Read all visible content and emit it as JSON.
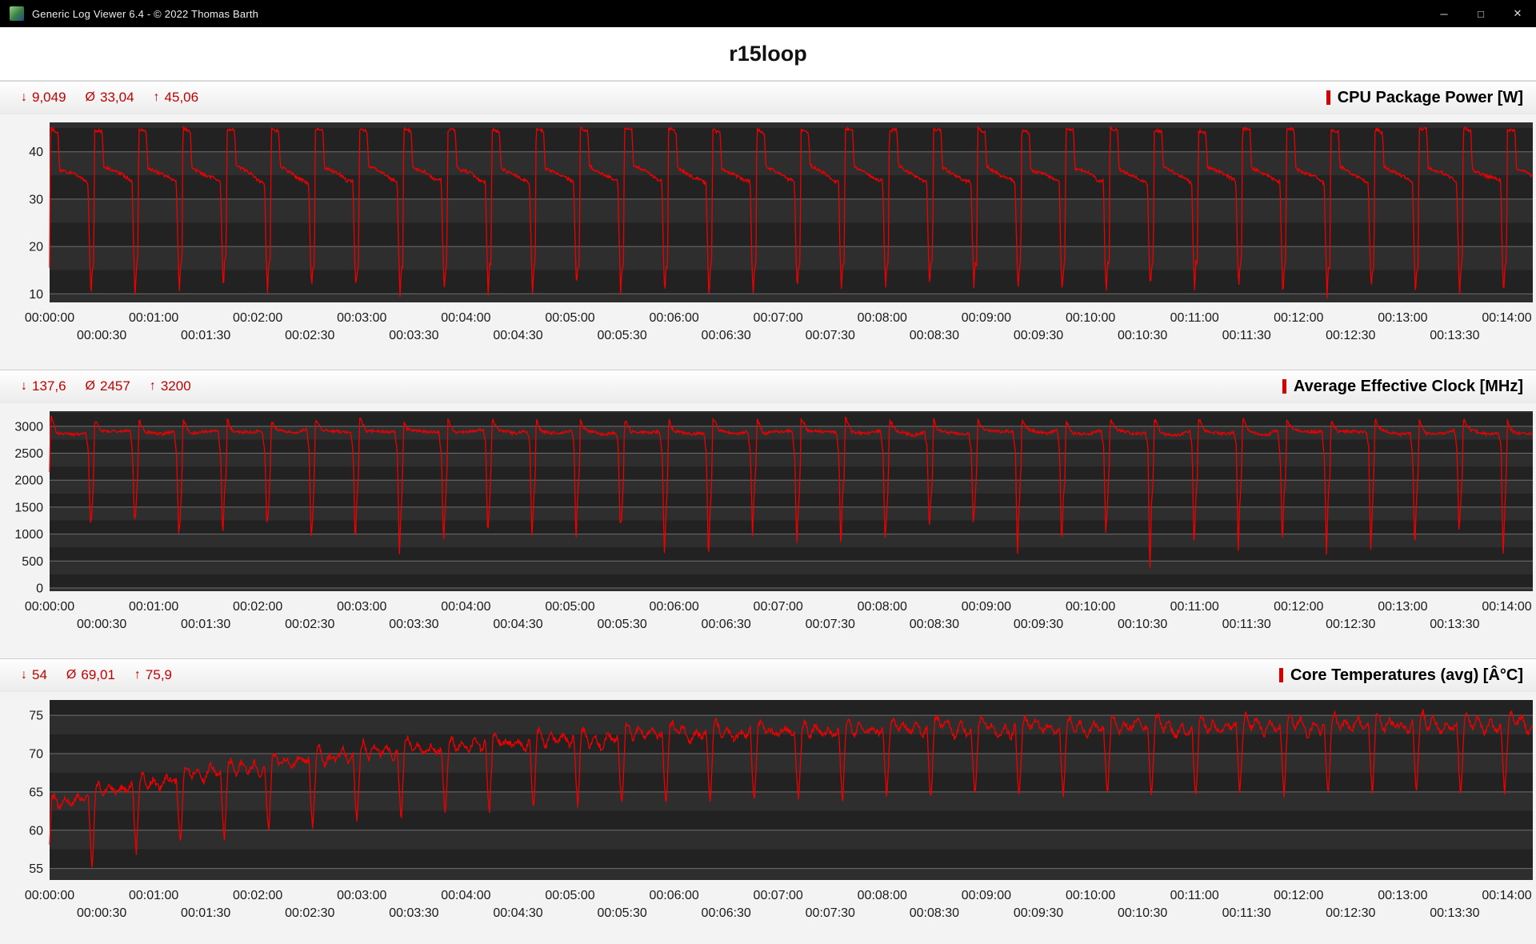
{
  "window": {
    "title": "Generic Log Viewer 6.4 - © 2022 Thomas Barth",
    "controls": {
      "minimize": "─",
      "maximize": "□",
      "close": "✕"
    }
  },
  "header": {
    "title": "r15loop"
  },
  "stats_glyphs": {
    "min": "↓",
    "avg": "Ø",
    "max": "↑"
  },
  "plot_colors": {
    "bg": "#1c1c1c",
    "stripe_light": "#2e2e2e",
    "stripe_dark": "#222222",
    "grid": "#6e6e6e",
    "tick_text": "#1a1a1a"
  },
  "axis": {
    "x_range": [
      0,
      855
    ],
    "row1_labels": [
      "00:00:00",
      "00:01:00",
      "00:02:00",
      "00:03:00",
      "00:04:00",
      "00:05:00",
      "00:06:00",
      "00:07:00",
      "00:08:00",
      "00:09:00",
      "00:10:00",
      "00:11:00",
      "00:12:00",
      "00:13:00",
      "00:14:00"
    ],
    "row1_seconds": [
      0,
      60,
      120,
      180,
      240,
      300,
      360,
      420,
      480,
      540,
      600,
      660,
      720,
      780,
      840
    ],
    "row2_labels": [
      "00:00:30",
      "00:01:30",
      "00:02:30",
      "00:03:30",
      "00:04:30",
      "00:05:30",
      "00:06:30",
      "00:07:30",
      "00:08:30",
      "00:09:30",
      "00:10:30",
      "00:11:30",
      "00:12:30",
      "00:13:30"
    ],
    "row2_seconds": [
      30,
      90,
      150,
      210,
      270,
      330,
      390,
      450,
      510,
      570,
      630,
      690,
      750,
      810
    ]
  },
  "chart_data": [
    {
      "type": "line",
      "name": "cpu-package-power",
      "title": "CPU Package Power [W]",
      "stats_display": {
        "min": "9,049",
        "avg": "33,04",
        "max": "45,06"
      },
      "legend_color": "#d40000",
      "line_color": "#ee0000",
      "y_ticks": [
        40,
        30,
        20,
        10
      ],
      "y_range": [
        8.2,
        46.2
      ],
      "stripe_step": 5,
      "series": {
        "mode": "absolute",
        "period": 25.45,
        "noise": 0.35,
        "seed": 3,
        "keypoints": [
          [
            0.0,
            17,
            1.5
          ],
          [
            0.02,
            44.8,
            0.4
          ],
          [
            0.19,
            44.3,
            0.5
          ],
          [
            0.225,
            36.6,
            0.6
          ],
          [
            0.56,
            35.2,
            0.5
          ],
          [
            0.74,
            34.2,
            0.4
          ],
          [
            0.87,
            33.6,
            0.4
          ],
          [
            0.905,
            19,
            2
          ],
          [
            0.935,
            10.3,
            1.4
          ],
          [
            0.962,
            15.5,
            1.5
          ],
          [
            1.0,
            17,
            1.5
          ]
        ],
        "overrides": [
          {
            "cycle": 0,
            "kp": 1,
            "value": 45.0
          }
        ]
      }
    },
    {
      "type": "line",
      "name": "average-effective-clock",
      "title": "Average Effective Clock [MHz]",
      "stats_display": {
        "min": "137,6",
        "avg": "2457",
        "max": "3200"
      },
      "legend_color": "#d40000",
      "line_color": "#ee0000",
      "y_ticks": [
        3000,
        2500,
        2000,
        1500,
        1000,
        500,
        0
      ],
      "y_range": [
        -60,
        3280
      ],
      "stripe_step": 250,
      "series": {
        "mode": "absolute",
        "period": 25.45,
        "noise": 28,
        "seed": 11,
        "keypoints": [
          [
            0.0,
            2150,
            150
          ],
          [
            0.022,
            3130,
            50
          ],
          [
            0.09,
            3010,
            60
          ],
          [
            0.17,
            2900,
            40
          ],
          [
            0.56,
            2870,
            40
          ],
          [
            0.82,
            2905,
            40
          ],
          [
            0.878,
            2550,
            180
          ],
          [
            0.922,
            780,
            420
          ],
          [
            0.957,
            1500,
            260
          ],
          [
            1.0,
            2150,
            150
          ]
        ],
        "overrides": [
          {
            "cycle": 0,
            "kp": 1,
            "value": 3200
          },
          {
            "cycle": 24,
            "kp": 7,
            "value": 145
          }
        ]
      }
    },
    {
      "type": "line",
      "name": "core-temperatures-avg",
      "title": "Core Temperatures (avg) [Â°C]",
      "stats_display": {
        "min": "54",
        "avg": "69,01",
        "max": "75,9"
      },
      "legend_color": "#d40000",
      "line_color": "#ee0000",
      "y_ticks": [
        75,
        70,
        65,
        60,
        55
      ],
      "y_range": [
        53.5,
        77.0
      ],
      "stripe_step": 2.5,
      "series": {
        "mode": "envelope",
        "period": 25.45,
        "noise": 0.4,
        "seed": 21,
        "peak_start": 64.6,
        "peak_end": 75.4,
        "tau": 175,
        "span": 11,
        "keypoints": [
          [
            0.0,
            0.42,
            0.05
          ],
          [
            0.045,
            0.93,
            0.05
          ],
          [
            0.105,
            1.0,
            0.03
          ],
          [
            0.22,
            0.8,
            0.06
          ],
          [
            0.34,
            0.93,
            0.05
          ],
          [
            0.5,
            0.77,
            0.06
          ],
          [
            0.64,
            0.92,
            0.05
          ],
          [
            0.78,
            0.78,
            0.06
          ],
          [
            0.875,
            0.88,
            0.05
          ],
          [
            0.925,
            0.3,
            0.07
          ],
          [
            0.962,
            0.02,
            0.03
          ],
          [
            1.0,
            0.42,
            0.05
          ]
        ],
        "overrides": []
      }
    }
  ]
}
